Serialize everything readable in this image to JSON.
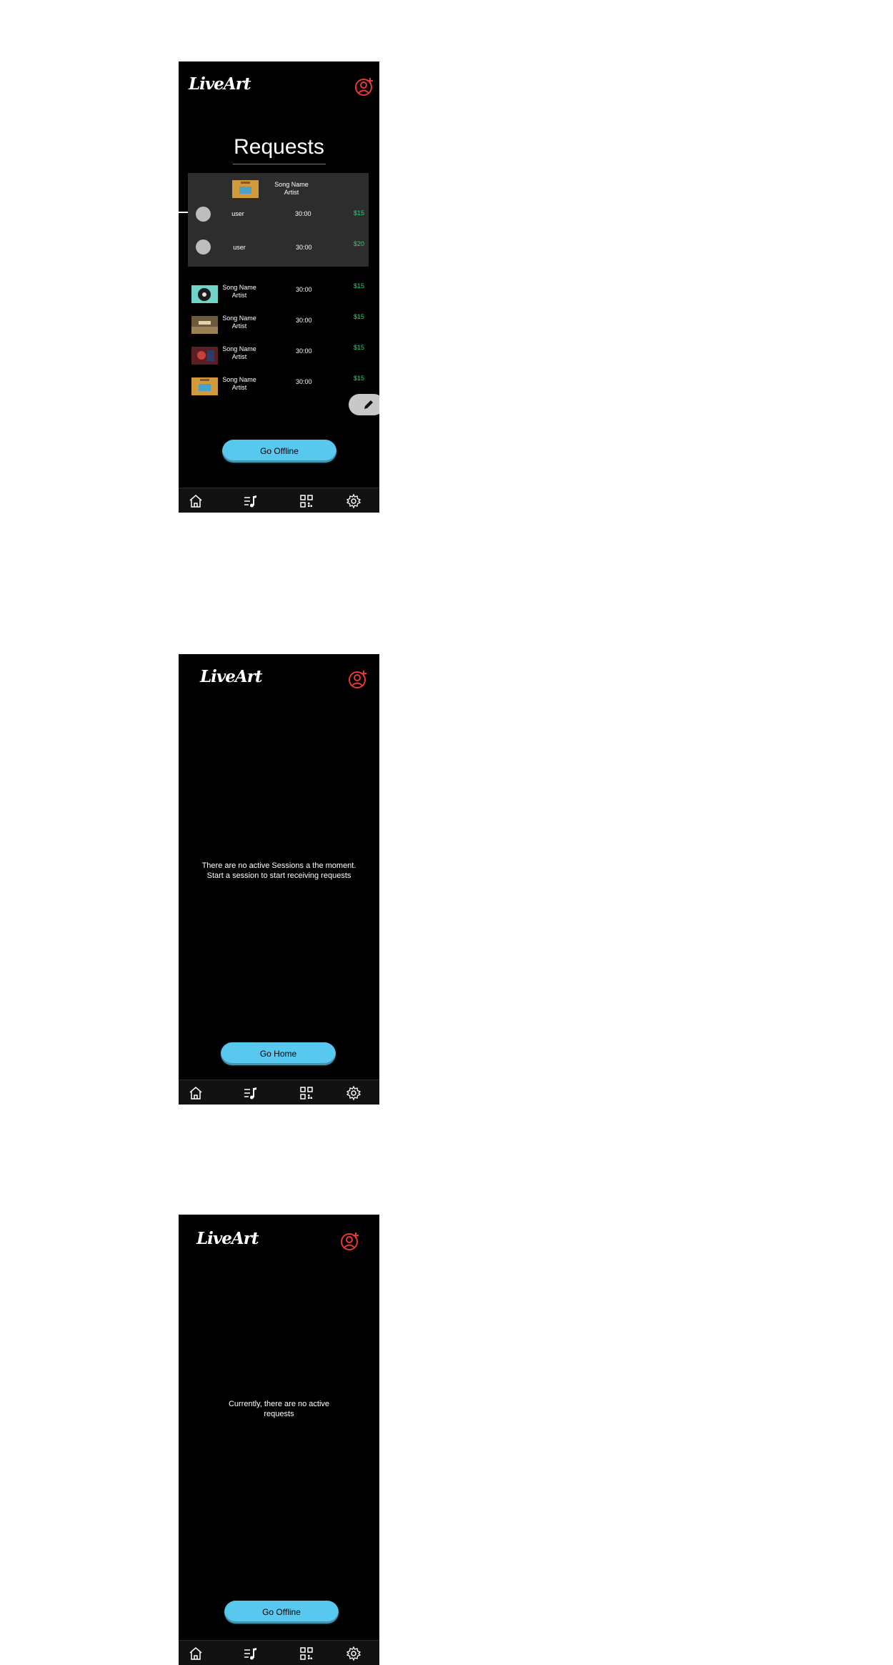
{
  "brand": {
    "logo_text": "LiveArt",
    "accent": "#e53935"
  },
  "screens": {
    "requests": {
      "title": "Requests",
      "featured": {
        "song_name": "Song Name",
        "artist": "Artist",
        "bids": [
          {
            "user": "user",
            "time": "30:00",
            "price": "$15"
          },
          {
            "user": "user",
            "time": "30:00",
            "price": "$20"
          }
        ]
      },
      "queue": [
        {
          "song_name": "Song Name",
          "artist": "Artist",
          "time": "30:00",
          "price": "$15"
        },
        {
          "song_name": "Song Name",
          "artist": "Artist",
          "time": "30:00",
          "price": "$15"
        },
        {
          "song_name": "Song Name",
          "artist": "Artist",
          "time": "30:00",
          "price": "$15"
        },
        {
          "song_name": "Song Name",
          "artist": "Artist",
          "time": "30:00",
          "price": "$15"
        }
      ],
      "button_label": "Go Offline"
    },
    "no_sessions": {
      "message_line1": "There are no active Sessions a the moment.",
      "message_line2": "Start a session to start receiving requests",
      "button_label": "Go Home"
    },
    "no_requests": {
      "message_line1": "Currently, there are no active",
      "message_line2": "requests",
      "button_label": "Go Offline"
    }
  },
  "nav": {
    "items": [
      {
        "icon": "home-icon"
      },
      {
        "icon": "playlist-icon"
      },
      {
        "icon": "qr-code-icon"
      },
      {
        "icon": "settings-icon"
      }
    ]
  },
  "colors": {
    "button": "#59c8ee",
    "price": "#2fd07a",
    "card": "#2d2d2d"
  }
}
